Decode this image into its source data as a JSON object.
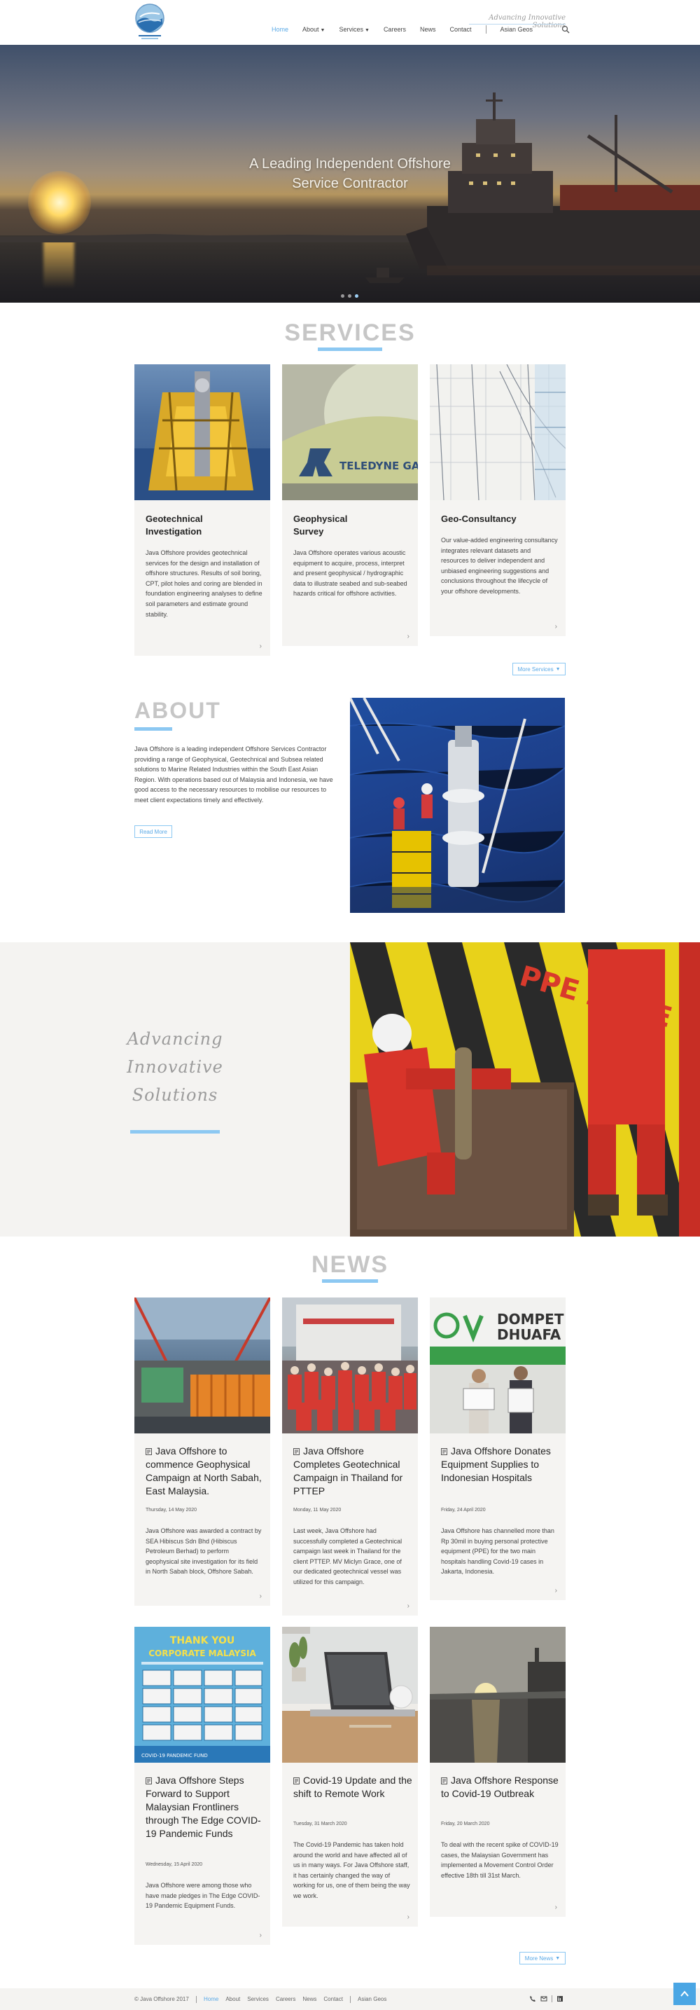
{
  "header": {
    "tagline": "Advancing Innovative Solutions",
    "logo_alt": "Java Offshore",
    "nav": [
      {
        "label": "Home",
        "active": true,
        "dropdown": false
      },
      {
        "label": "About",
        "active": false,
        "dropdown": true
      },
      {
        "label": "Services",
        "active": false,
        "dropdown": true
      },
      {
        "label": "Careers",
        "active": false,
        "dropdown": false
      },
      {
        "label": "News",
        "active": false,
        "dropdown": false
      },
      {
        "label": "Contact",
        "active": false,
        "dropdown": false
      },
      {
        "label": "Asian Geos",
        "active": false,
        "dropdown": false
      }
    ],
    "search_icon": "search-icon"
  },
  "hero": {
    "title_line1": "A Leading Independent Offshore",
    "title_line2": "Service Contractor",
    "slides": 3,
    "active_slide": 3
  },
  "services": {
    "title": "SERVICES",
    "cards": [
      {
        "title_line1": "Geotechnical",
        "title_line2": "Investigation",
        "text": "Java Offshore provides geotechnical services for the design and installation of offshore structures. Results of soil boring, CPT, pilot holes and coring are blended in foundation engineering analyses to define soil parameters and estimate ground stability."
      },
      {
        "title_line1": "Geophysical",
        "title_line2": "Survey",
        "text": "Java Offshore operates various acoustic equipment to acquire, process, interpret and present geophysical / hydrographic data to illustrate seabed and sub-seabed hazards critical for offshore activities."
      },
      {
        "title_line1": "Geo-Consultancy",
        "title_line2": "",
        "text": "Our value-added engineering consultancy integrates relevant datasets and resources to deliver independent and unbiased engineering suggestions and conclusions throughout the lifecycle of your offshore developments."
      }
    ],
    "more_label": "More Services",
    "image_label": "TELEDYNE GAV"
  },
  "about": {
    "title": "ABOUT",
    "text": "Java Offshore is a leading independent Offshore Services Contractor providing a range of Geophysical, Geotechnical and Subsea related solutions to Marine Related Industries within the South East Asian Region. With operations based out of Malaysia and Indonesia, we have good access to the necessary resources to mobilise our resources to meet client expectations timely and effectively.",
    "read_more": "Read More"
  },
  "advancing": {
    "line1": "Advancing",
    "line2": "Innovative",
    "line3": "Solutions",
    "sign_text": "PPE ZONE"
  },
  "news": {
    "title": "NEWS",
    "cards": [
      {
        "title": "Java Offshore to commence Geophysical Campaign at North Sabah, East Malaysia.",
        "date": "Thursday, 14 May 2020",
        "text": "Java Offshore was awarded a contract by SEA Hibiscus Sdn Bhd (Hibiscus Petroleum Berhad) to perform geophysical site investigation for its field in North Sabah block, Offshore Sabah."
      },
      {
        "title": "Java Offshore Completes Geotechnical Campaign in Thailand for PTTEP",
        "date": "Monday, 11 May 2020",
        "text": "Last week, Java Offshore had successfully completed a Geotechnical campaign last week in Thailand for the client PTTEP. MV Miclyn Grace, one of our dedicated geotechnical vessel was utilized for this campaign."
      },
      {
        "title": "Java Offshore Donates Equipment Supplies to Indonesian Hospitals",
        "date": "Friday, 24 April 2020",
        "text": "Java Offshore has channelled more than Rp 30mil in buying personal protective equipment (PPE) for the two main hospitals handling Covid-19 cases in Jakarta, Indonesia."
      },
      {
        "title": "Java Offshore Steps Forward to Support Malaysian Frontliners through The Edge COVID-19 Pandemic Funds",
        "date": "Wednesday, 15 April 2020",
        "text": "Java Offshore were among those who have made pledges in The Edge COVID-19 Pandemic Equipment Funds."
      },
      {
        "title": "Covid-19 Update and the shift to Remote Work",
        "date": "Tuesday, 31 March 2020",
        "text": "The Covid-19 Pandemic has taken hold around the world and have affected all of us in many ways. For Java Offshore staff, it has certainly changed the way of working for us, one of them being the way we work."
      },
      {
        "title": "Java Offshore Response to Covid-19 Outbreak",
        "date": "Friday, 20 March 2020",
        "text": "To deal with the recent spike of COVID-19 cases, the Malaysian Government has implemented a Movement Control Order effective 18th till 31st March."
      }
    ],
    "poster_line1": "THANK YOU",
    "poster_line2": "CORPORATE MALAYSIA",
    "poster_footer": "COVID-19 PANDEMIC FUND",
    "dompet_line1": "DOMPET",
    "dompet_line2": "DHUAFA",
    "more_label": "More News"
  },
  "footer": {
    "copyright": "© Java Offshore 2017",
    "nav": [
      "Home",
      "About",
      "Services",
      "Careers",
      "News",
      "Contact",
      "Asian Geos"
    ]
  }
}
